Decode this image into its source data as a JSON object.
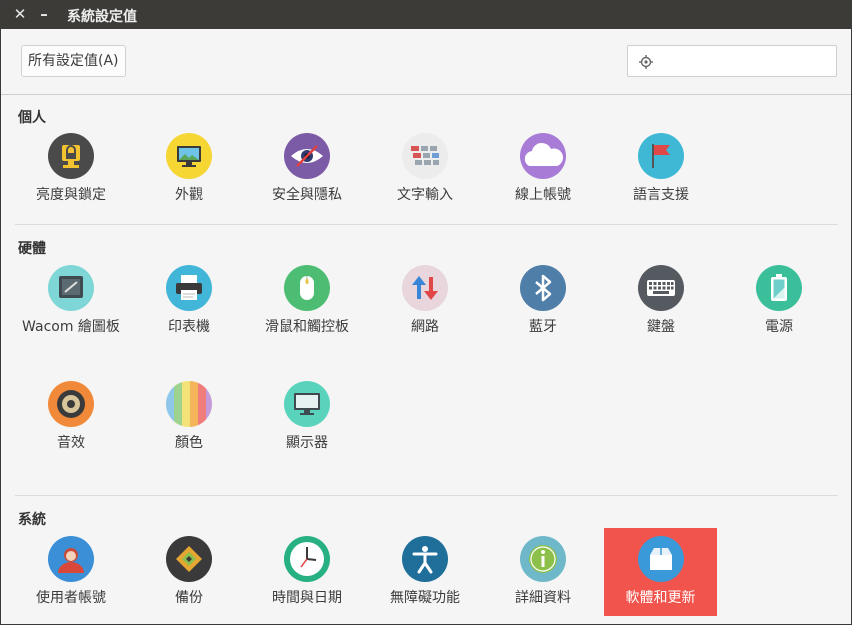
{
  "window": {
    "title": "系統設定值",
    "close_icon": "close-icon",
    "minimize_icon": "minimize-icon"
  },
  "toolbar": {
    "all_settings_label": "所有設定值(A)",
    "search_placeholder": "",
    "search_icon": "search-locator-icon"
  },
  "sections": {
    "personal": {
      "title": "個人",
      "items": [
        {
          "label": "亮度與鎖定",
          "icon": "lock-icon"
        },
        {
          "label": "外觀",
          "icon": "appearance-monitor-icon"
        },
        {
          "label": "安全與隱私",
          "icon": "privacy-eye-icon"
        },
        {
          "label": "文字輸入",
          "icon": "keyboard-input-icon"
        },
        {
          "label": "線上帳號",
          "icon": "cloud-icon"
        },
        {
          "label": "語言支援",
          "icon": "flag-icon"
        }
      ]
    },
    "hardware": {
      "title": "硬體",
      "items": [
        {
          "label": "Wacom 繪圖板",
          "icon": "tablet-icon"
        },
        {
          "label": "印表機",
          "icon": "printer-icon"
        },
        {
          "label": "滑鼠和觸控板",
          "icon": "mouse-icon"
        },
        {
          "label": "網路",
          "icon": "network-arrows-icon"
        },
        {
          "label": "藍牙",
          "icon": "bluetooth-icon"
        },
        {
          "label": "鍵盤",
          "icon": "keyboard-icon"
        },
        {
          "label": "電源",
          "icon": "battery-icon"
        },
        {
          "label": "音效",
          "icon": "speaker-icon"
        },
        {
          "label": "顏色",
          "icon": "color-stripes-icon"
        },
        {
          "label": "顯示器",
          "icon": "display-icon"
        }
      ]
    },
    "system": {
      "title": "系統",
      "items": [
        {
          "label": "使用者帳號",
          "icon": "user-icon"
        },
        {
          "label": "備份",
          "icon": "backup-icon"
        },
        {
          "label": "時間與日期",
          "icon": "clock-icon"
        },
        {
          "label": "無障礙功能",
          "icon": "accessibility-icon"
        },
        {
          "label": "詳細資料",
          "icon": "info-icon"
        },
        {
          "label": "軟體和更新",
          "icon": "software-box-icon",
          "selected": true
        }
      ]
    }
  },
  "colors": {
    "titlebar": "#3c3b37",
    "selected": "#f0544c",
    "background": "#f5f5f5"
  }
}
